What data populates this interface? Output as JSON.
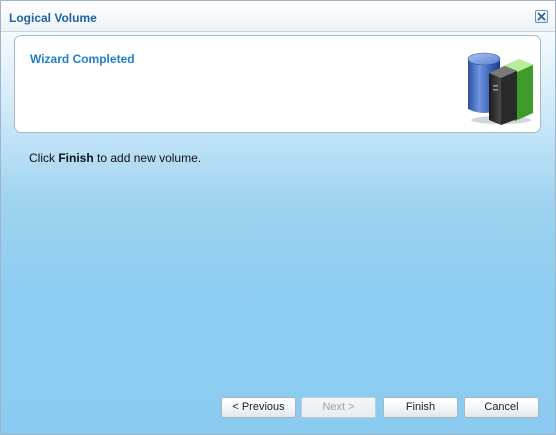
{
  "window": {
    "title": "Logical Volume",
    "close_icon": "close-icon"
  },
  "header": {
    "title": "Wizard Completed",
    "graphic_icon": "storage-volume-books-icon"
  },
  "body": {
    "instruction_prefix": "Click ",
    "instruction_bold": "Finish",
    "instruction_suffix": " to add new volume."
  },
  "buttons": {
    "previous": "< Previous",
    "next": "Next >",
    "finish": "Finish",
    "cancel": "Cancel"
  },
  "colors": {
    "title_text": "#1e64a0",
    "header_title": "#1f80c8",
    "background_bottom": "#8ccbf1"
  }
}
